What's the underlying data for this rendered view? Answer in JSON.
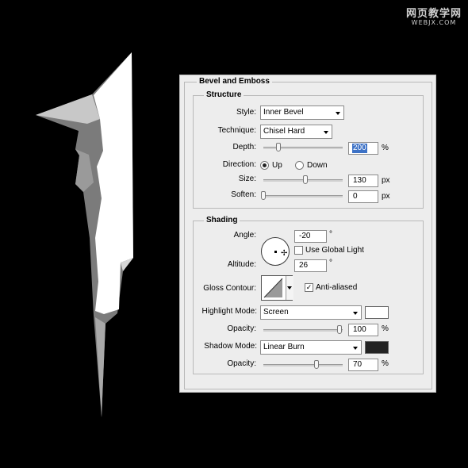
{
  "watermark": {
    "line1": "网页教学网",
    "line2": "WEBJX.COM"
  },
  "dialog": {
    "title": "Bevel and Emboss",
    "structure": {
      "title": "Structure",
      "style_label": "Style:",
      "style_value": "Inner Bevel",
      "technique_label": "Technique:",
      "technique_value": "Chisel Hard",
      "depth_label": "Depth:",
      "depth_value": "200",
      "depth_unit": "%",
      "depth_level": 0.2,
      "direction_label": "Direction:",
      "direction_up": "Up",
      "direction_down": "Down",
      "direction_selected": "Up",
      "size_label": "Size:",
      "size_value": "130",
      "size_unit": "px",
      "size_level": 0.55,
      "soften_label": "Soften:",
      "soften_value": "0",
      "soften_unit": "px",
      "soften_level": 0
    },
    "shading": {
      "title": "Shading",
      "angle_label": "Angle:",
      "angle_value": "-20",
      "angle_unit": "°",
      "use_global_light_label": "Use Global Light",
      "use_global_light_checked": false,
      "altitude_label": "Altitude:",
      "altitude_value": "26",
      "altitude_unit": "°",
      "gloss_contour_label": "Gloss Contour:",
      "anti_aliased_label": "Anti-aliased",
      "anti_aliased_checked": true,
      "highlight_mode_label": "Highlight Mode:",
      "highlight_mode_value": "Screen",
      "highlight_color": "#ffffff",
      "highlight_opacity_label": "Opacity:",
      "highlight_opacity_value": "100",
      "highlight_opacity_unit": "%",
      "highlight_opacity_level": 1.0,
      "shadow_mode_label": "Shadow Mode:",
      "shadow_mode_value": "Linear Burn",
      "shadow_color": "#222222",
      "shadow_opacity_label": "Opacity:",
      "shadow_opacity_value": "70",
      "shadow_opacity_unit": "%",
      "shadow_opacity_level": 0.7
    }
  }
}
